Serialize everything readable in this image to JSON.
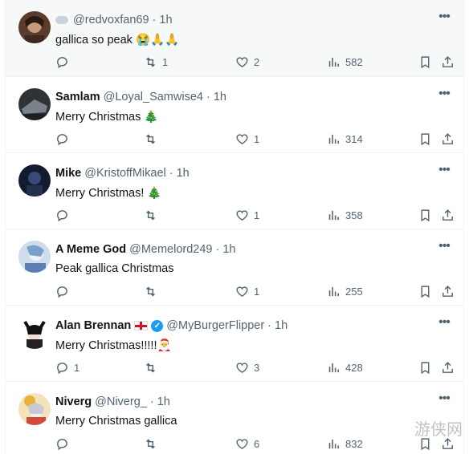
{
  "colors": {
    "muted": "#536471",
    "text": "#0f1419",
    "verified": "#1d9bf0",
    "divider": "#eff3f4"
  },
  "tweets": [
    {
      "name": "",
      "handle": "@redvoxfan69",
      "dot": "·",
      "time": "1h",
      "text": "gallica so peak 😭🙏🙏",
      "replies": "",
      "retweets": "1",
      "likes": "2",
      "views": "582",
      "avatar_color": "#6b4a3a"
    },
    {
      "name": "Samlam",
      "handle": "@Loyal_Samwise4",
      "dot": "·",
      "time": "1h",
      "text": "Merry Christmas 🎄",
      "replies": "",
      "retweets": "",
      "likes": "1",
      "views": "314",
      "avatar_color": "#3a3f45"
    },
    {
      "name": "Mike",
      "handle": "@KristoffMikael",
      "dot": "·",
      "time": "1h",
      "text": "Merry Christmas! 🎄",
      "replies": "",
      "retweets": "",
      "likes": "1",
      "views": "358",
      "avatar_color": "#1f2a44"
    },
    {
      "name": "A Meme God",
      "handle": "@Memelord249",
      "dot": "·",
      "time": "1h",
      "text": "Peak gallica Christmas",
      "replies": "",
      "retweets": "",
      "likes": "1",
      "views": "255",
      "avatar_color": "#6f8fb8"
    },
    {
      "name": "Alan Brennan",
      "handle": "@MyBurgerFlipper",
      "dot": "·",
      "time": "1h",
      "text": "Merry Christmas!!!!!🎅",
      "replies": "1",
      "retweets": "",
      "likes": "3",
      "views": "428",
      "avatar_color": "#2b2b2b"
    },
    {
      "name": "Niverg",
      "handle": "@Niverg_",
      "dot": "·",
      "time": "1h",
      "text": "Merry Christmas gallica",
      "replies": "",
      "retweets": "",
      "likes": "6",
      "views": "832",
      "avatar_color": "#d9a84a"
    }
  ],
  "watermark": "游侠网"
}
